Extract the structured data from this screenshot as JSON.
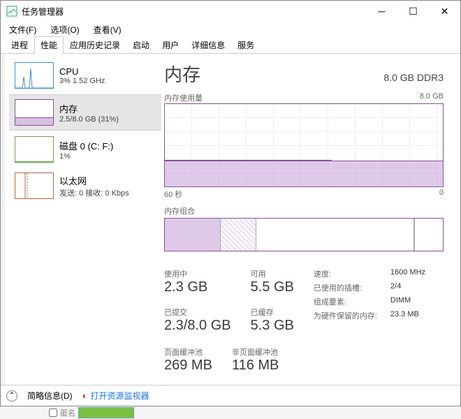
{
  "window": {
    "title": "任务管理器"
  },
  "menu": {
    "file": "文件(F)",
    "options": "选项(O)",
    "view": "查看(V)"
  },
  "tabs": [
    "进程",
    "性能",
    "应用历史记录",
    "启动",
    "用户",
    "详细信息",
    "服务"
  ],
  "activeTab": 1,
  "sidebar": [
    {
      "title": "CPU",
      "sub": "3% 1.52 GHz",
      "color": "#3b8dd4"
    },
    {
      "title": "内存",
      "sub": "2.5/8.0 GB (31%)",
      "color": "#8b4f9b"
    },
    {
      "title": "磁盘 0 (C: F:)",
      "sub": "1%",
      "color": "#6aa84f"
    },
    {
      "title": "以太网",
      "sub": "发送: 0 接收: 0 Kbps",
      "color": "#b06a3b"
    }
  ],
  "detail": {
    "title": "内存",
    "capacity": "8.0 GB DDR3",
    "chart1": {
      "label": "内存使用量",
      "max": "8.0 GB",
      "xleft": "60 秒",
      "xright": "0"
    },
    "chart2": {
      "label": "内存组合"
    },
    "stats": {
      "in_use": {
        "label": "使用中",
        "value": "2.3 GB"
      },
      "available": {
        "label": "可用",
        "value": "5.5 GB"
      },
      "committed": {
        "label": "已提交",
        "value": "2.3/8.0 GB"
      },
      "cached": {
        "label": "已缓存",
        "value": "5.3 GB"
      },
      "paged": {
        "label": "页面缓冲池",
        "value": "269 MB"
      },
      "nonpaged": {
        "label": "非页面缓冲池",
        "value": "116 MB"
      }
    },
    "meta": {
      "speed_k": "速度:",
      "speed_v": "1600 MHz",
      "slots_k": "已使用的插槽:",
      "slots_v": "2/4",
      "form_k": "组成要素:",
      "form_v": "DIMM",
      "reserved_k": "为硬件保留的内存:",
      "reserved_v": "23.3 MB"
    }
  },
  "footer": {
    "simple": "简略信息(D)",
    "resmon": "打开资源监视器"
  },
  "bottom": {
    "anon": "匿名"
  },
  "chart_data": {
    "type": "area",
    "title": "内存使用量",
    "ylabel": "GB",
    "ylim": [
      0,
      8.0
    ],
    "xlabel": "秒",
    "xlim": [
      60,
      0
    ],
    "series": [
      {
        "name": "使用中",
        "values_gb_approx": [
          2.5,
          2.5,
          2.5,
          2.5,
          2.5,
          2.5,
          2.5,
          2.5,
          2.5,
          2.5,
          2.5,
          2.5,
          2.5,
          2.5,
          2.5,
          2.5,
          2.5,
          2.5,
          2.5,
          2.5,
          2.5,
          2.5,
          2.5,
          2.5,
          2.5,
          2.5,
          2.5,
          2.5,
          2.5,
          2.5,
          2.5,
          2.5,
          2.5,
          2.5,
          2.5,
          2.5,
          2.5,
          2.5,
          2.5,
          2.5,
          2.5,
          2.5,
          2.5,
          2.5,
          2.5,
          2.5,
          2.5,
          2.5,
          2.5,
          2.5,
          2.5,
          2.5,
          2.5,
          2.5,
          2.5,
          2.5,
          2.5,
          2.5,
          2.5,
          2.5
        ]
      }
    ],
    "composition": {
      "total_gb": 8.0,
      "in_use_gb": 2.3,
      "modified_gb": 0.2,
      "standby_gb": 5.3,
      "free_gb": 0.2
    }
  }
}
